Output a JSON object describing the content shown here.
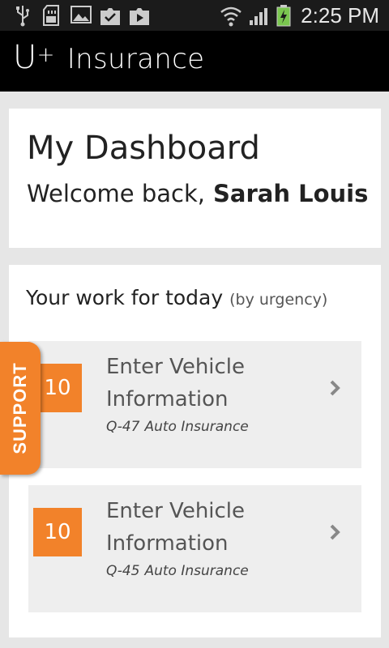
{
  "status_bar": {
    "time": "2:25 PM",
    "icons": [
      "usb-icon",
      "sd-card-icon",
      "image-icon",
      "download-done-icon",
      "media-icon",
      "wifi-icon",
      "signal-icon",
      "battery-charging-icon"
    ]
  },
  "app": {
    "title_u": "U",
    "title_plus": "+",
    "title_rest": "Insurance"
  },
  "dashboard": {
    "title": "My Dashboard",
    "welcome_prefix": "Welcome back,",
    "user_name": "Sarah Louis"
  },
  "work": {
    "heading": "Your work for today",
    "heading_sub": "(by urgency)",
    "tasks": [
      {
        "urgency": "10",
        "title": "Enter Vehicle Information",
        "quote": "Q-47",
        "type": "Auto Insurance"
      },
      {
        "urgency": "10",
        "title": "Enter Vehicle Information",
        "quote": "Q-45",
        "type": "Auto Insurance"
      }
    ]
  },
  "support": {
    "label": "SUPPORT"
  },
  "colors": {
    "accent": "#f2822a",
    "header_bg": "#000000",
    "page_bg": "#e6e6e6",
    "task_bg": "#eeeeee"
  }
}
